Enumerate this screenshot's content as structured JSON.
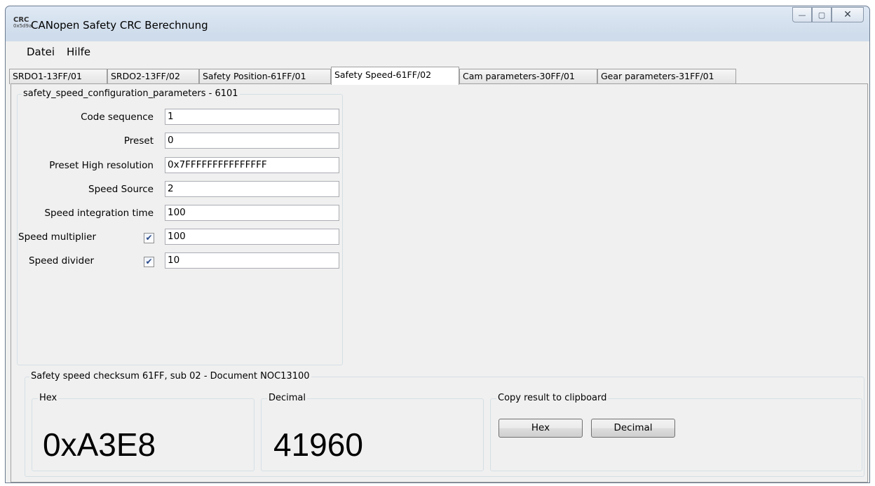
{
  "window": {
    "icon_text_top": "CRC",
    "icon_text_bottom": "0x5d9a",
    "title": "CANopen Safety CRC Berechnung",
    "minimize_glyph": "—",
    "maximize_glyph": "▢",
    "close_glyph": "✕"
  },
  "menu": {
    "items": [
      "Datei",
      "Hilfe"
    ]
  },
  "tabs": [
    "SRDO1-13FF/01",
    "SRDO2-13FF/02",
    "Safety Position-61FF/01",
    "Safety Speed-61FF/02",
    "Cam parameters-30FF/01",
    "Gear parameters-31FF/01"
  ],
  "active_tab": "Safety Speed-61FF/02",
  "config": {
    "title": "safety_speed_configuration_parameters - 6101",
    "fields": [
      {
        "label": "Code sequence",
        "value": "1"
      },
      {
        "label": "Preset",
        "value": "0"
      },
      {
        "label": "Preset High resolution",
        "value": "0x7FFFFFFFFFFFFFFF"
      },
      {
        "label": "Speed Source",
        "value": "2"
      },
      {
        "label": "Speed integration time",
        "value": "100"
      },
      {
        "label": "Speed multiplier",
        "value": "100",
        "checked": true
      },
      {
        "label": "Speed divider",
        "value": "10",
        "checked": true
      }
    ],
    "check_glyph": "✔"
  },
  "checksum": {
    "title": "Safety speed checksum 61FF, sub 02 - Document NOC13100",
    "hex_label": "Hex",
    "hex_value": "0xA3E8",
    "decimal_label": "Decimal",
    "decimal_value": "41960",
    "copy_label": "Copy result to clipboard",
    "copy_hex_button": "Hex",
    "copy_decimal_button": "Decimal"
  }
}
